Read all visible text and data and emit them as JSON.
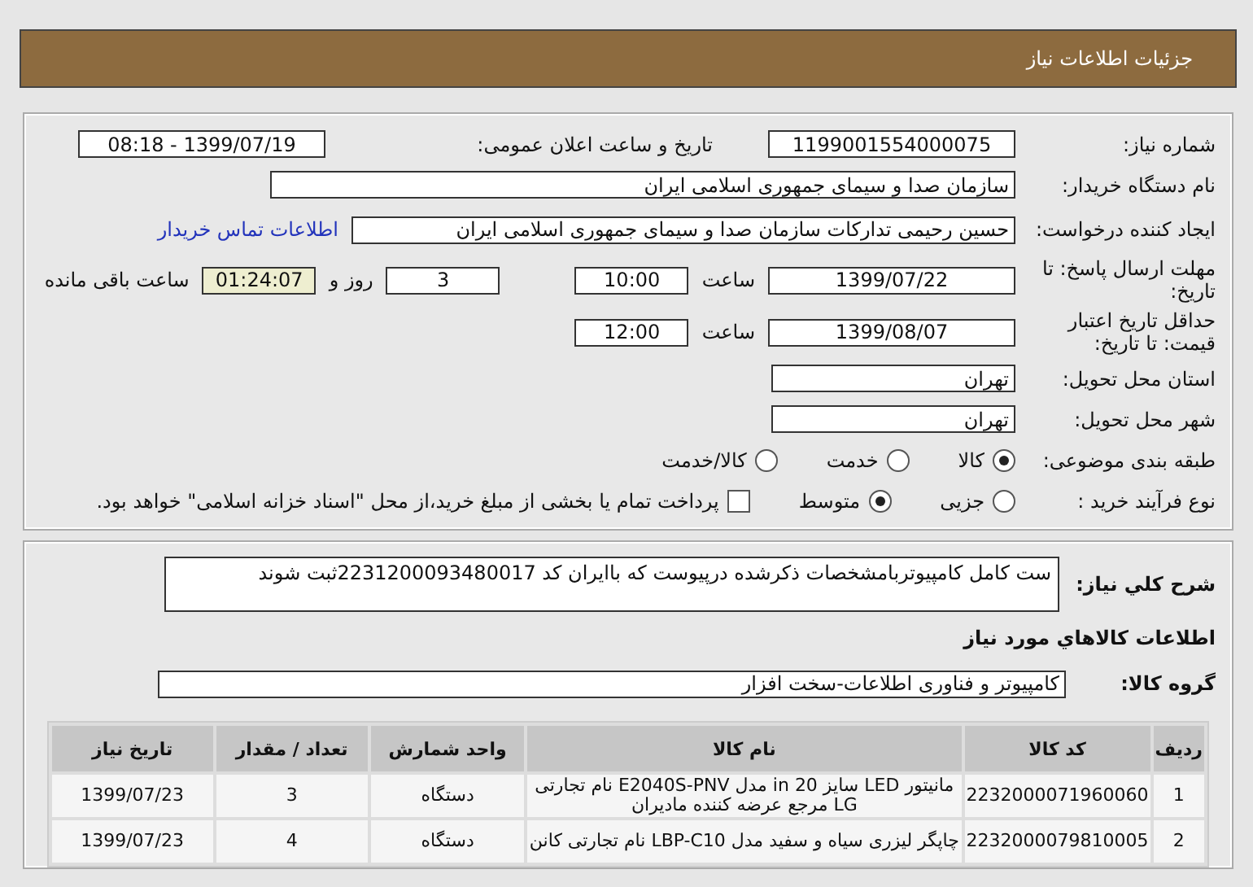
{
  "header": {
    "title": "جزئیات اطلاعات نیاز"
  },
  "details": {
    "need_number": {
      "label": "شماره نیاز:",
      "value": "1199001554000075"
    },
    "announce": {
      "label": "تاریخ و ساعت اعلان عمومی:",
      "value": "1399/07/19 - 08:18"
    },
    "buyer_org": {
      "label": "نام دستگاه خریدار:",
      "value": "سازمان صدا و سیمای جمهوری اسلامی ایران"
    },
    "requester": {
      "label": "ایجاد کننده درخواست:",
      "value": "حسین رحیمی تدارکات سازمان صدا و سیمای جمهوری اسلامی ایران",
      "contact_link": "اطلاعات تماس خریدار"
    },
    "response_deadline": {
      "label": "مهلت ارسال پاسخ: تا تاریخ:",
      "date": "1399/07/22",
      "time_label": "ساعت",
      "time": "10:00",
      "days": "3",
      "days_label": "روز و",
      "remaining": "01:24:07",
      "remaining_label": "ساعت باقی مانده"
    },
    "price_validity": {
      "label": "حداقل تاریخ اعتبار قیمت: تا تاریخ:",
      "date": "1399/08/07",
      "time_label": "ساعت",
      "time": "12:00"
    },
    "province": {
      "label": "استان محل تحویل:",
      "value": "تهران"
    },
    "city": {
      "label": "شهر محل تحویل:",
      "value": "تهران"
    },
    "category": {
      "label": "طبقه بندی موضوعی:",
      "options": [
        {
          "label": "کالا",
          "selected": true
        },
        {
          "label": "خدمت",
          "selected": false
        },
        {
          "label": "کالا/خدمت",
          "selected": false
        }
      ]
    },
    "process": {
      "label": "نوع فرآیند خرید :",
      "options": [
        {
          "label": "جزیی",
          "selected": false
        },
        {
          "label": "متوسط",
          "selected": true
        }
      ],
      "treasury": {
        "label": "پرداخت تمام یا بخشی از مبلغ خرید،از محل \"اسناد خزانه اسلامی\" خواهد بود.",
        "checked": false
      }
    }
  },
  "summary": {
    "label": "شرح کلي نياز:",
    "value": "ست کامل کامپیوتربامشخصات ذکرشده درپیوست که باایران کد 2231200093480017ثبت شوند"
  },
  "goods": {
    "title": "اطلاعات کالاهاي مورد نياز",
    "group": {
      "label": "گروه کالا:",
      "value": "کامپیوتر و فناوری اطلاعات-سخت افزار"
    },
    "table": {
      "columns": [
        "ردیف",
        "کد کالا",
        "نام کالا",
        "واحد شمارش",
        "تعداد / مقدار",
        "تاریخ نیاز"
      ],
      "rows": [
        [
          "1",
          "2232000071960060",
          "مانیتور LED سایز 20 in مدل E2040S-PNV نام تجارتی LG مرجع عرضه کننده مادیران",
          "دستگاه",
          "3",
          "1399/07/23"
        ],
        [
          "2",
          "2232000079810005",
          "چاپگر لیزری سیاه و سفید مدل LBP-C10 نام تجارتی کانن",
          "دستگاه",
          "4",
          "1399/07/23"
        ]
      ]
    }
  }
}
